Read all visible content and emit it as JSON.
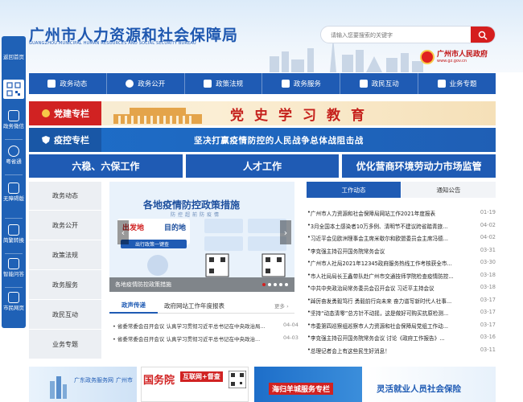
{
  "header": {
    "title": "广州市人力资源和社会保障局",
    "subtitle": "GUANGZHOU MUNICIPAL HUMAN RESOURCES AND SOCIAL SECURITY BUREAU",
    "search_placeholder": "请输入您要搜索的关键字",
    "gov_name": "广州市人民政府",
    "gov_url": "www.gz.gov.cn"
  },
  "sidebar": {
    "items": [
      {
        "label": "返回首页"
      },
      {
        "label": "政务微信"
      },
      {
        "label": "粤省通"
      },
      {
        "label": "无障碍版"
      },
      {
        "label": "简繁转换"
      },
      {
        "label": "智能问答"
      },
      {
        "label": "市民网页"
      }
    ]
  },
  "nav": {
    "items": [
      {
        "label": "政务动态"
      },
      {
        "label": "政务公开"
      },
      {
        "label": "政策法规"
      },
      {
        "label": "政务服务"
      },
      {
        "label": "政民互动"
      },
      {
        "label": "业务专题"
      }
    ]
  },
  "banners": {
    "party_tag": "党建专栏",
    "party_text": "党史学习教育",
    "covid_tag": "疫控专栏",
    "covid_text": "坚决打赢疫情防控的人民战争总体战阻击战"
  },
  "topics": [
    "六稳、六保工作",
    "人才工作",
    "优化营商环境劳动力市场监管"
  ],
  "left_menu": [
    "政务动态",
    "政务公开",
    "政策法规",
    "政务服务",
    "政民互动",
    "业务专题"
  ],
  "slider": {
    "title": "各地疫情防控政策措施",
    "subtitle": "防控超前防疫情",
    "badge": "出发地",
    "destination": "目的地",
    "query_button": "出行政策一键查",
    "caption": "各地疫情防控政策措施"
  },
  "left_tabs": {
    "active": "政声传递",
    "other": "政府网站工作年度报表",
    "more": "更多 ›",
    "items": [
      {
        "title": "省委常委会召开会议 认真学习贯彻习近平总书记在中央政治局...",
        "date": "04-04"
      },
      {
        "title": "省委常委会召开会议 认真学习贯彻习近平总书记在中央政治...",
        "date": "04-03"
      }
    ]
  },
  "right_tabs": {
    "active": "工作动态",
    "other": "通知公告",
    "items": [
      {
        "title": "广州市人力资源和社会保障局网站工作2021年度报表",
        "date": "01-19"
      },
      {
        "title": "3月全国本土感染者10万多例、清明节不建议跨省踏青旅...",
        "date": "04-02"
      },
      {
        "title": "习近平会见欧洲理事会主席米歇尔和欧盟委员会主席冯德...",
        "date": "04-02"
      },
      {
        "title": "李克强主持召开国务院常务会议",
        "date": "03-31"
      },
      {
        "title": "广州市人社局2021年12345政府服务热线工作考核获全市...",
        "date": "03-30"
      },
      {
        "title": "市人社局局长王鑫带队赴广州市交通技师学院检查疫情防控...",
        "date": "03-18"
      },
      {
        "title": "中共中央政治局常务委员会召开会议 习近平主持会议",
        "date": "03-18"
      },
      {
        "title": "踔厉奋发勇毅笃行 勇毅前行向未来 奋力谱写新时代人社事...",
        "date": "03-17"
      },
      {
        "title": "坚持“动态清零”总方针不动摇，这是做好可购买抗原检测...",
        "date": "03-17"
      },
      {
        "title": "市委第四巡察组巡察市人力资源和社会保障局党组工作动...",
        "date": "03-17"
      },
      {
        "title": "李克强主持召开国务院常务会议 讨论《政府工作报告》...",
        "date": "03-16"
      },
      {
        "title": "总理记者会上有这些民生好消息！",
        "date": "03-11"
      }
    ]
  },
  "bottom": {
    "card1_title": "广东政务服务网",
    "card1_city": "广州市",
    "card2_title": "国务院",
    "card2_tag": "互联网+督查",
    "card3_text": "海归羊城服务专栏",
    "card4_text": "灵活就业人员社会保险"
  },
  "colors": {
    "primary": "#1f5bb4",
    "red": "#d12222"
  }
}
